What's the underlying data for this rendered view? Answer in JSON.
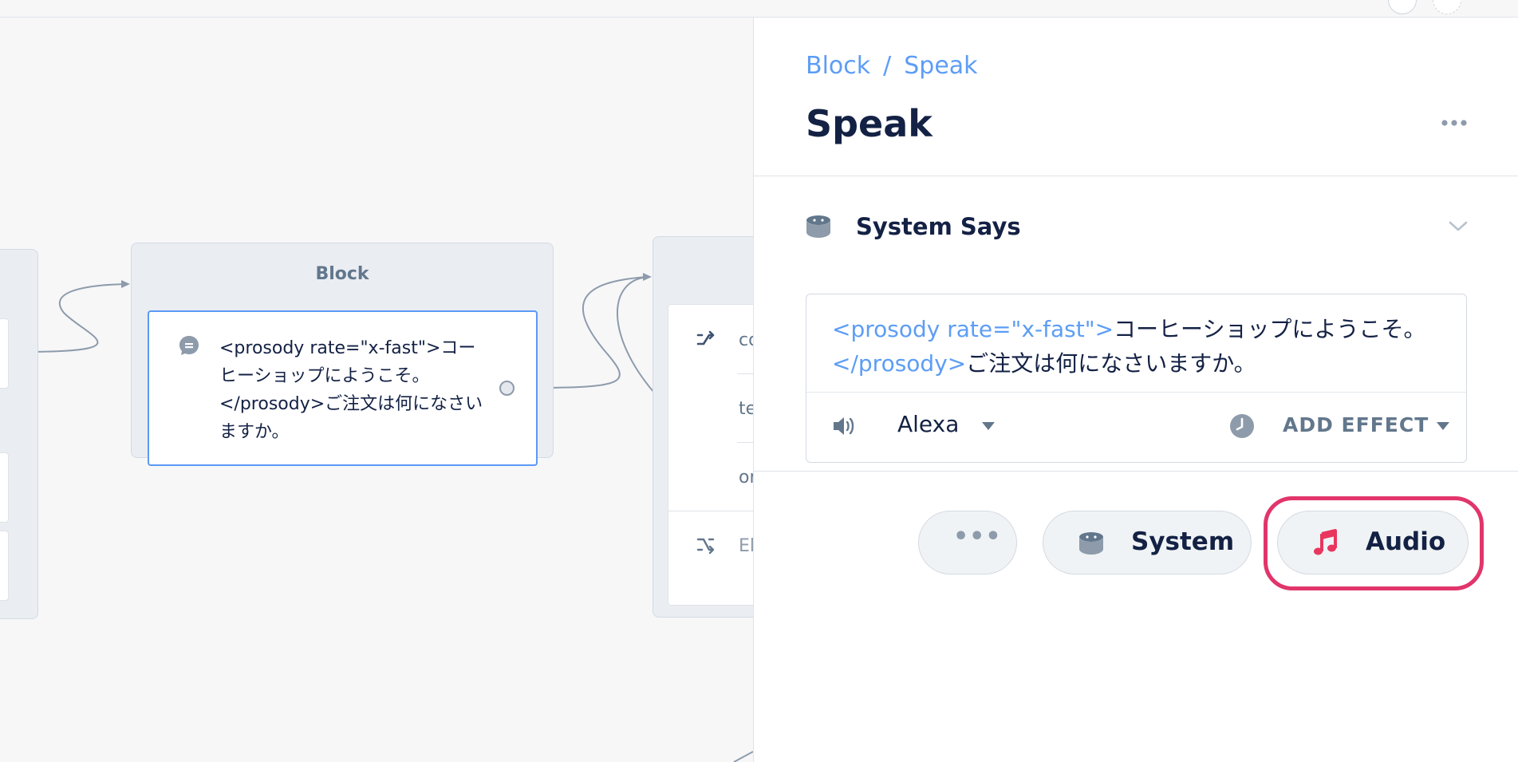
{
  "canvas": {
    "block": {
      "title": "Block",
      "speak_step_text": "<prosody rate=\"x-fast\">コーヒーショップにようこそ。</prosody>ご注文は何になさいますか。",
      "speak_icon": "speech-bubble-icon"
    },
    "next_block": {
      "rows": [
        "co",
        "te",
        "or"
      ],
      "else_label": "El",
      "row_icon": "shuffle-icon"
    }
  },
  "panel": {
    "breadcrumb": [
      "Block",
      "Speak"
    ],
    "breadcrumb_separator": "/",
    "title": "Speak",
    "more_icon": "ellipsis-icon",
    "section": {
      "title": "System Says",
      "icon": "speaker-device-icon",
      "toggle_icon": "chevron-down-icon"
    },
    "speak": {
      "ssml_open": "<prosody rate=\"x-fast\">",
      "text_1": "コーヒーショップにようこそ。",
      "ssml_close": "</prosody>",
      "text_2": "ご注文は何になさいますか。",
      "voice": "Alexa",
      "effect_label": "ADD EFFECT"
    },
    "add_buttons": {
      "more_label": "•••",
      "system_label": "System",
      "audio_label": "Audio"
    }
  },
  "colors": {
    "accent_blue": "#5d9df5",
    "highlight": "#e1356b",
    "audio_icon": "#e8365f",
    "text_dark": "#132144",
    "text_muted": "#62778c"
  }
}
